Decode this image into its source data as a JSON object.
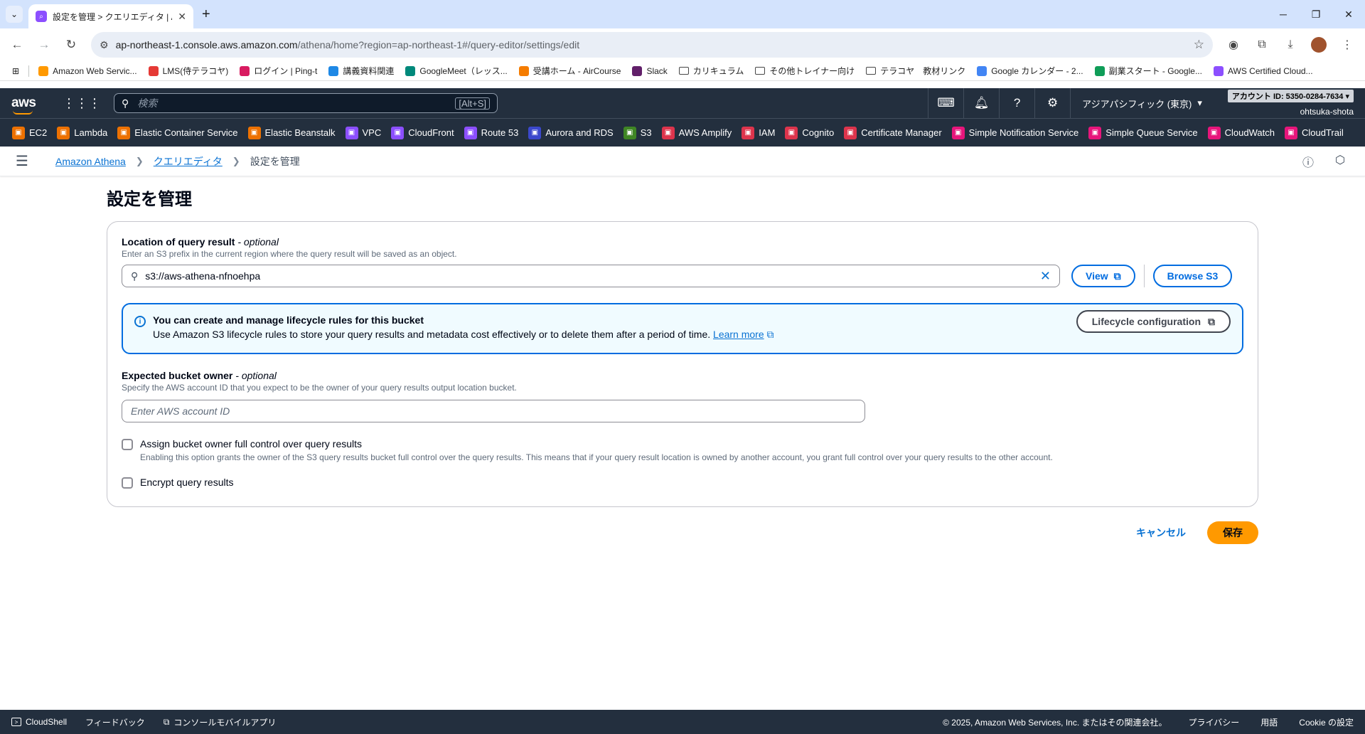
{
  "browser": {
    "tab_title": "設定を管理 > クエリエディタ | Athe",
    "url_host": "ap-northeast-1.console.aws.amazon.com",
    "url_path": "/athena/home?region=ap-northeast-1#/query-editor/settings/edit",
    "bookmarks": [
      {
        "label": "Amazon Web Servic...",
        "icon": "aws-icon",
        "color": "#ff9900"
      },
      {
        "label": "LMS(侍テラコヤ)",
        "icon": "lms-icon",
        "color": "#e53935"
      },
      {
        "label": "ログイン | Ping-t",
        "icon": "pingt-icon",
        "color": "#d81b60"
      },
      {
        "label": "講義資料関連",
        "icon": "drive-icon",
        "color": "#1e88e5"
      },
      {
        "label": "GoogleMeet（レッス...",
        "icon": "meet-icon",
        "color": "#00897b"
      },
      {
        "label": "受講ホーム - AirCourse",
        "icon": "aircourse-icon",
        "color": "#f57c00"
      },
      {
        "label": "Slack",
        "icon": "slack-icon",
        "color": "#611f69"
      },
      {
        "label": "カリキュラム",
        "icon": "folder-icon",
        "color": ""
      },
      {
        "label": "その他トレイナー向け",
        "icon": "folder-icon",
        "color": ""
      },
      {
        "label": "テラコヤ　教材リンク",
        "icon": "folder-icon",
        "color": ""
      },
      {
        "label": "Google カレンダー - 2...",
        "icon": "calendar-icon",
        "color": "#4285f4"
      },
      {
        "label": "副業スタート - Google...",
        "icon": "sheets-icon",
        "color": "#0f9d58"
      },
      {
        "label": "AWS Certified Cloud...",
        "icon": "cert-icon",
        "color": "#8c4fff"
      }
    ]
  },
  "aws": {
    "search_placeholder": "検索",
    "search_shortcut": "[Alt+S]",
    "region": "アジアパシフィック (東京)",
    "account_id": "アカウント ID: 5350-0284-7634 ▾",
    "username": "ohtsuka-shota",
    "services": [
      {
        "label": "EC2",
        "color": "#ed7100"
      },
      {
        "label": "Lambda",
        "color": "#ed7100"
      },
      {
        "label": "Elastic Container Service",
        "color": "#ed7100"
      },
      {
        "label": "Elastic Beanstalk",
        "color": "#ed7100"
      },
      {
        "label": "VPC",
        "color": "#8c4fff"
      },
      {
        "label": "CloudFront",
        "color": "#8c4fff"
      },
      {
        "label": "Route 53",
        "color": "#8c4fff"
      },
      {
        "label": "Aurora and RDS",
        "color": "#3b48cc"
      },
      {
        "label": "S3",
        "color": "#3f8624"
      },
      {
        "label": "AWS Amplify",
        "color": "#dd344c"
      },
      {
        "label": "IAM",
        "color": "#dd344c"
      },
      {
        "label": "Cognito",
        "color": "#dd344c"
      },
      {
        "label": "Certificate Manager",
        "color": "#dd344c"
      },
      {
        "label": "Simple Notification Service",
        "color": "#e7157b"
      },
      {
        "label": "Simple Queue Service",
        "color": "#e7157b"
      },
      {
        "label": "CloudWatch",
        "color": "#e7157b"
      },
      {
        "label": "CloudTrail",
        "color": "#e7157b"
      }
    ]
  },
  "breadcrumb": {
    "items": [
      "Amazon Athena",
      "クエリエディタ"
    ],
    "current": "設定を管理"
  },
  "page": {
    "title": "設定を管理",
    "location_label": "Location of query result",
    "location_optional": "- optional",
    "location_desc": "Enter an S3 prefix in the current region where the query result will be saved as an object.",
    "location_value": "s3://aws-athena-nfnoehpa",
    "view_label": "View",
    "browse_label": "Browse S3",
    "info_heading": "You can create and manage lifecycle rules for this bucket",
    "info_body": "Use Amazon S3 lifecycle rules to store your query results and metadata cost effectively or to delete them after a period of time.",
    "info_link": "Learn more",
    "lifecycle_label": "Lifecycle configuration",
    "owner_label": "Expected bucket owner",
    "owner_optional": "- optional",
    "owner_desc": "Specify the AWS account ID that you expect to be the owner of your query results output location bucket.",
    "owner_placeholder": "Enter AWS account ID",
    "assign_label": "Assign bucket owner full control over query results",
    "assign_desc": "Enabling this option grants the owner of the S3 query results bucket full control over the query results. This means that if your query result location is owned by another account, you grant full control over your query results to the other account.",
    "encrypt_label": "Encrypt query results",
    "cancel_label": "キャンセル",
    "save_label": "保存"
  },
  "footer": {
    "cloudshell": "CloudShell",
    "feedback": "フィードバック",
    "mobile": "コンソールモバイルアプリ",
    "copyright": "© 2025, Amazon Web Services, Inc. またはその関連会社。",
    "privacy": "プライバシー",
    "terms": "用語",
    "cookie": "Cookie の設定"
  }
}
